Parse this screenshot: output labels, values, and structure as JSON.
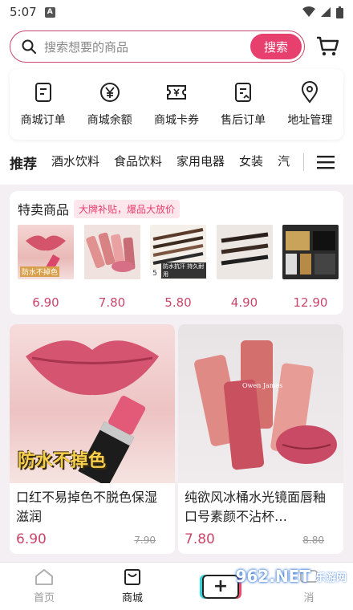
{
  "status": {
    "time": "5:07",
    "a_badge": "A"
  },
  "search": {
    "placeholder": "搜索想要的商品",
    "button": "搜索"
  },
  "quick_links": [
    {
      "label": "商城订单",
      "icon": "order-icon"
    },
    {
      "label": "商城余额",
      "icon": "yuan-icon"
    },
    {
      "label": "商城卡券",
      "icon": "ticket-icon"
    },
    {
      "label": "售后订单",
      "icon": "after-sale-icon"
    },
    {
      "label": "地址管理",
      "icon": "location-icon"
    }
  ],
  "tabs": [
    "推荐",
    "酒水饮料",
    "食品饮料",
    "家用电器",
    "女装",
    "汽"
  ],
  "sale": {
    "title": "特卖商品",
    "badge": "大牌补贴，爆品大放价",
    "items": [
      {
        "price": "6.90",
        "overlay": "防水不掉色"
      },
      {
        "price": "7.80",
        "overlay": ""
      },
      {
        "price": "5.80",
        "overlay": "防水抗汗 持久耐用",
        "corner": "5"
      },
      {
        "price": "4.90",
        "overlay": ""
      },
      {
        "price": "12.90",
        "overlay": ""
      }
    ]
  },
  "products": [
    {
      "title": "口红不易掉色不脱色保湿滋润",
      "price": "6.90",
      "original": "7.90",
      "overlay": "防水不掉色"
    },
    {
      "title": "纯欲风冰桶水光镜面唇釉口号素颜不沾杯…",
      "price": "7.80",
      "original": "8.80",
      "brand_text": "Owen James"
    }
  ],
  "nav": [
    {
      "label": "首页",
      "icon": "home-icon"
    },
    {
      "label": "商城",
      "icon": "shop-icon"
    },
    {
      "label": "",
      "icon": "plus-icon"
    },
    {
      "label": "消",
      "icon": "message-icon"
    }
  ],
  "watermark": {
    "main": "962.NET",
    "sub": "乐游网"
  },
  "colors": {
    "accent": "#e8406e",
    "price": "#c9466a",
    "background": "#f3eff3"
  }
}
